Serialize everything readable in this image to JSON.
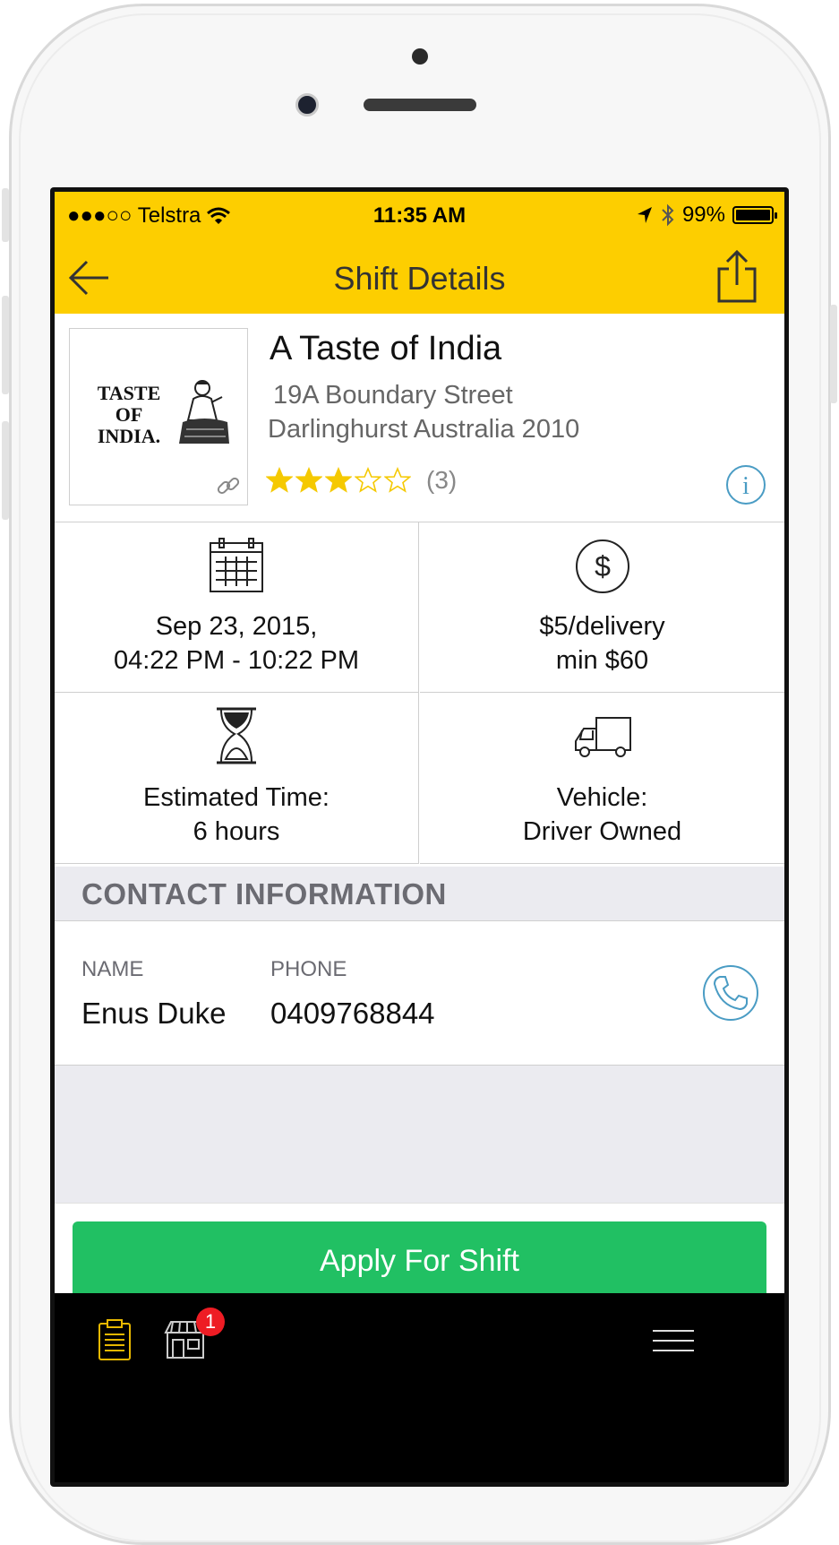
{
  "status_bar": {
    "carrier": "●●●○○ Telstra",
    "time": "11:35 AM",
    "battery": "99%"
  },
  "nav": {
    "title": "Shift Details"
  },
  "restaurant": {
    "logo_text_line1": "TASTE",
    "logo_text_line2": "OF",
    "logo_text_line3": "INDIA.",
    "name": "A Taste of India",
    "address_line1": "19A Boundary Street",
    "address_line2": "Darlinghurst Australia 2010",
    "rating_stars": 3,
    "rating_max": 5,
    "rating_count": "(3)"
  },
  "details": {
    "date_line1": "Sep 23, 2015,",
    "date_line2": "04:22 PM - 10:22 PM",
    "pay_line1": "$5/delivery",
    "pay_line2": "min $60",
    "time_line1": "Estimated Time:",
    "time_line2": "6 hours",
    "vehicle_line1": "Vehicle:",
    "vehicle_line2": "Driver Owned"
  },
  "contact": {
    "section_title": "CONTACT INFORMATION",
    "name_label": "NAME",
    "name_value": "Enus Duke",
    "phone_label": "PHONE",
    "phone_value": "0409768844"
  },
  "actions": {
    "apply_label": "Apply For Shift"
  },
  "tabbar": {
    "badge_count": "1"
  },
  "colors": {
    "accent_yellow": "#fdce00",
    "apply_green": "#21c063",
    "icon_blue": "#4a9cc4",
    "star_gold": "#f5c900",
    "badge_red": "#ee1c24"
  },
  "icons": [
    "back-arrow-icon",
    "share-icon",
    "link-icon",
    "star-icon",
    "info-icon",
    "calendar-icon",
    "dollar-icon",
    "hourglass-icon",
    "truck-icon",
    "phone-icon",
    "clipboard-icon",
    "store-icon",
    "menu-icon"
  ]
}
